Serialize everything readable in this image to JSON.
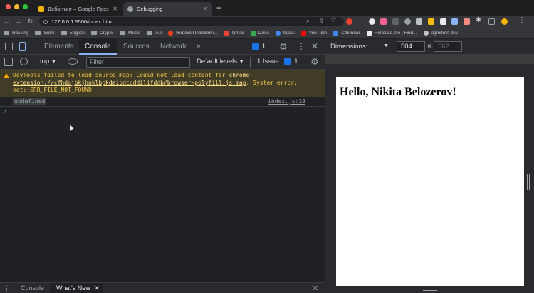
{
  "browser": {
    "tabs": [
      {
        "label": "Дебаггинг – Google Презентации",
        "active": false,
        "favicon_color": "#f4b400"
      },
      {
        "label": "Debugging",
        "active": true,
        "favicon_color": "#9aa0a6"
      }
    ],
    "url": "127.0.0.1:5500/index.html",
    "bookmarks": [
      "Hacking",
      "Work",
      "English",
      "Crypto",
      "Music",
      "AU",
      "Яндекс.Переводч...",
      "Gmail",
      "Drive",
      "Maps",
      "YouTube",
      "Calendar",
      "Relocate.me | Find...",
      "agmitron.dev"
    ]
  },
  "devtools": {
    "tabs": [
      "Elements",
      "Console",
      "Sources",
      "Network"
    ],
    "active_tab": "Console",
    "more_tabs_glyph": "»",
    "issues_count": "1",
    "context": "top",
    "filter_placeholder": "Filter",
    "levels": "Default levels",
    "issue_label": "1 Issue:",
    "issue_count": "1",
    "warning": {
      "text1": "DevTools failed to load source map: Could not load content for ",
      "link": "chrome-extension://cfhdojbkjhnklbpkdaibdccddilifddb/browser-polyfill.js.map",
      "text2": ": System error: net::ERR_FILE_NOT_FOUND"
    },
    "log": {
      "value": "undefined",
      "source": "index.js:19"
    },
    "drawer_tabs": [
      "Console",
      "What's New"
    ],
    "prompt_glyph": "›"
  },
  "preview": {
    "dimensions_label": "Dimensions: ...",
    "width": "504",
    "height": "562",
    "times": "×",
    "page_heading": "Hello, Nikita Belozerov!"
  },
  "colors": {
    "accent": "#8ab4f8",
    "warning_bg": "#413c26",
    "warning_text": "#f2c94c"
  }
}
